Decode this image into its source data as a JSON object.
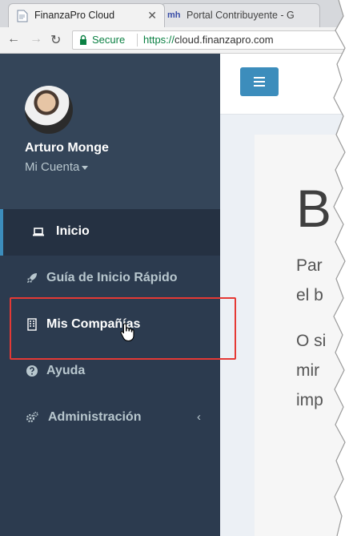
{
  "browser": {
    "tabs": [
      {
        "title": "FinanzaPro Cloud",
        "active": true
      },
      {
        "title": "Portal Contribuyente - G",
        "active": false,
        "favicon_text": "mh"
      }
    ],
    "security_label": "Secure",
    "url_scheme": "https://",
    "url_host": "cloud.finanzapro.com"
  },
  "sidebar": {
    "user_name": "Arturo Monge",
    "account_label": "Mi Cuenta",
    "items": [
      {
        "label": "Inicio",
        "icon": "laptop-icon",
        "active": true
      },
      {
        "label": "Guía de Inicio Rápido",
        "icon": "rocket-icon",
        "active": false
      },
      {
        "label": "Mis Compañías",
        "icon": "building-icon",
        "active": false,
        "highlighted": true
      },
      {
        "label": "Ayuda",
        "icon": "question-circle-icon",
        "active": false
      },
      {
        "label": "Administración",
        "icon": "cogs-icon",
        "active": false,
        "submenu": true
      }
    ]
  },
  "content": {
    "heading_fragment": "B",
    "lines": [
      "Par",
      "el b",
      "O si",
      "mir",
      "imp"
    ]
  },
  "colors": {
    "sidebar_bg": "#2c3b4f",
    "accent": "#3c8dbc",
    "highlight_box": "#e53935",
    "secure_green": "#0b8043"
  }
}
